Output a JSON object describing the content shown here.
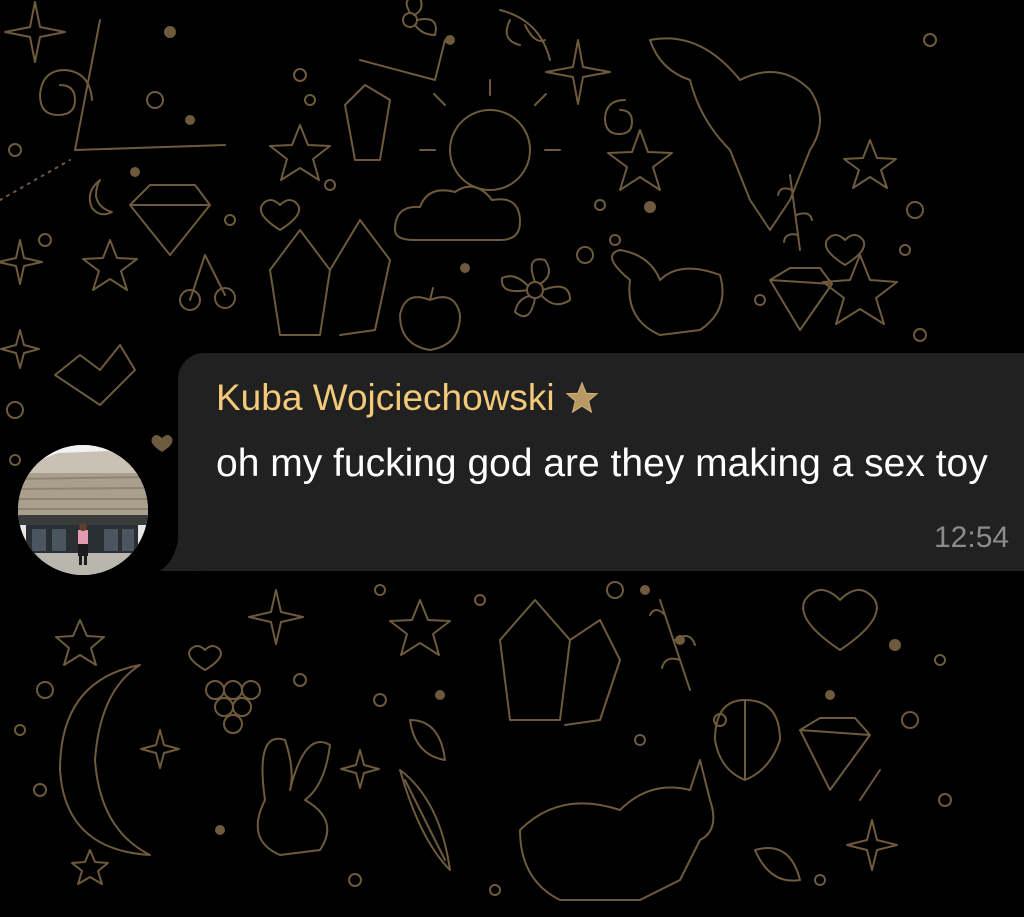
{
  "message": {
    "sender_name": "Kuba Wojciechowski",
    "sender_badge_icon": "star-icon",
    "text": "oh my fucking god are they making a sex toy",
    "time": "12:54"
  },
  "colors": {
    "background": "#000000",
    "doodle": "#6e5a3c",
    "bubble": "#212121",
    "sender_name": "#f3c97a",
    "message_text": "#ffffff",
    "timestamp": "#8c8c8c"
  }
}
